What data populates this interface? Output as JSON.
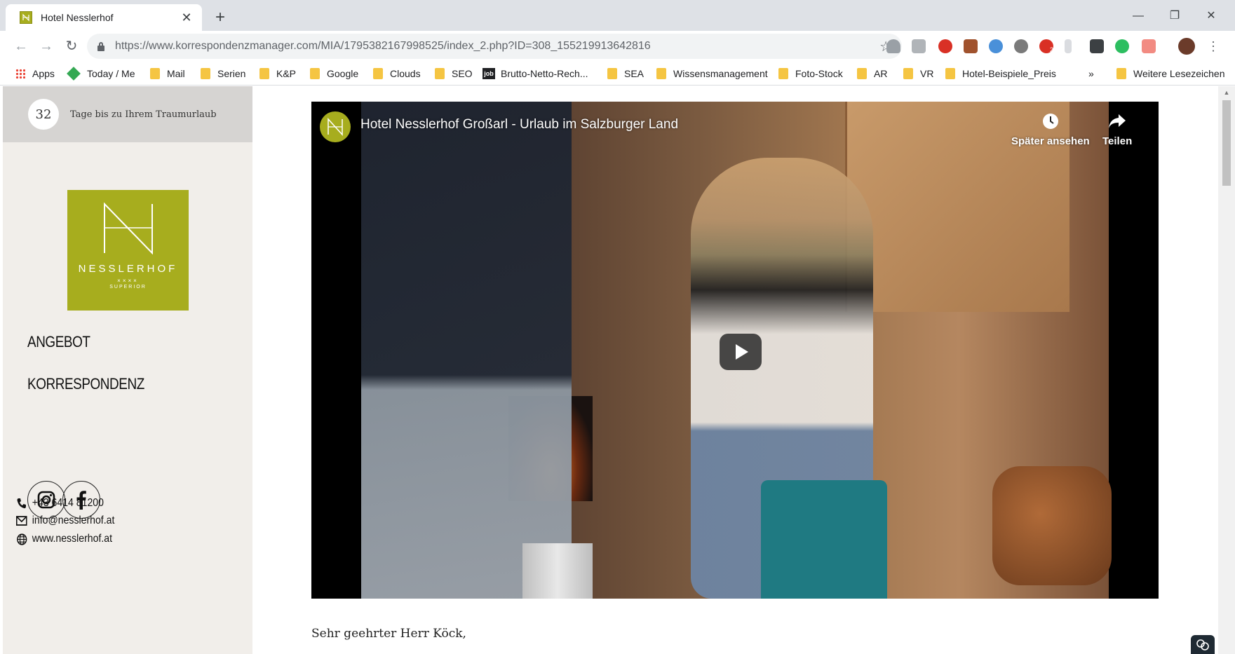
{
  "browser": {
    "tab_title": "Hotel Nesslerhof",
    "tab_close": "✕",
    "new_tab": "+",
    "window_minimize": "—",
    "window_restore": "❐",
    "window_close": "✕",
    "url": "https://www.korrespondenzmanager.com/MIA/1795382167998525/index_2.php?ID=308_155219913642816",
    "extension_badge": "2"
  },
  "bookmarks": {
    "items": [
      {
        "label": "Apps",
        "icon": "apps-grid-icon"
      },
      {
        "label": "Today / Me",
        "icon": "diamond-icon"
      },
      {
        "label": "Mail",
        "icon": "folder-icon"
      },
      {
        "label": "Serien",
        "icon": "folder-icon"
      },
      {
        "label": "K&P",
        "icon": "folder-icon"
      },
      {
        "label": "Google",
        "icon": "folder-icon"
      },
      {
        "label": "Clouds",
        "icon": "folder-icon"
      },
      {
        "label": "SEO",
        "icon": "folder-icon"
      },
      {
        "label": "Brutto-Netto-Rech...",
        "icon": "job-icon"
      },
      {
        "label": "SEA",
        "icon": "folder-icon"
      },
      {
        "label": "Wissensmanagement",
        "icon": "folder-icon"
      },
      {
        "label": "Foto-Stock",
        "icon": "folder-icon"
      },
      {
        "label": "AR",
        "icon": "folder-icon"
      },
      {
        "label": "VR",
        "icon": "folder-icon"
      },
      {
        "label": "Hotel-Beispiele_Preis",
        "icon": "folder-icon"
      }
    ],
    "overflow": "»",
    "other": "Weitere Lesezeichen",
    "job_icon_text": "job"
  },
  "sidebar": {
    "countdown_number": "32",
    "countdown_text": "Tage bis zu Ihrem Traumurlaub",
    "logo_name": "NESSLERHOF",
    "logo_stars": "××××",
    "logo_sub": "SUPERIOR",
    "menu": [
      "ANGEBOT",
      "KORRESPONDENZ"
    ],
    "phone": "+43 6414 81200",
    "email": "info@nesslerhof.at",
    "website": "www.nesslerhof.at"
  },
  "video": {
    "title": "Hotel Nesslerhof Großarl - Urlaub im Salzburger Land",
    "watch_later": "Später ansehen",
    "share": "Teilen"
  },
  "content": {
    "greeting": "Sehr geehrter Herr Köck,"
  },
  "colors": {
    "brand": "#a7ad1e",
    "sidebar_bg": "#f1eeea",
    "countdown_bg": "#d6d4d2"
  }
}
